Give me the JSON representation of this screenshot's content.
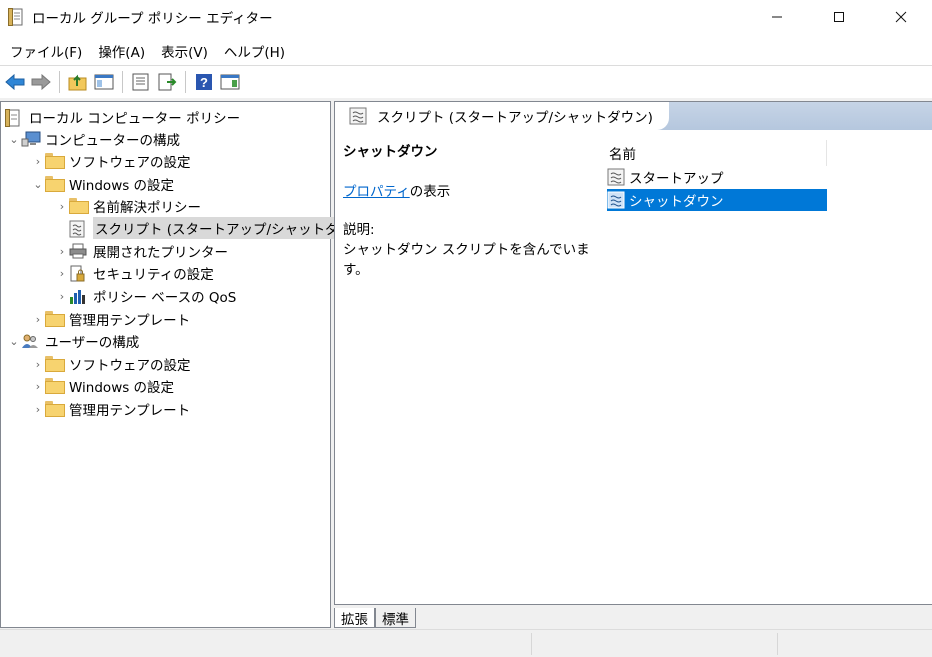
{
  "window": {
    "title": "ローカル グループ ポリシー エディター",
    "minimize": "—",
    "maximize": "☐",
    "close": "✕"
  },
  "menu": [
    "ファイル(F)",
    "操作(A)",
    "表示(V)",
    "ヘルプ(H)"
  ],
  "tree": {
    "root": "ローカル コンピューター ポリシー",
    "computer_config": "コンピューターの構成",
    "c_software": "ソフトウェアの設定",
    "c_windows": "Windows の設定",
    "c_name_resolution": "名前解決ポリシー",
    "c_scripts": "スクリプト (スタートアップ/シャットダウン)",
    "c_printers": "展開されたプリンター",
    "c_security": "セキュリティの設定",
    "c_qos": "ポリシー ベースの QoS",
    "c_admin_templates": "管理用テンプレート",
    "user_config": "ユーザーの構成",
    "u_software": "ソフトウェアの設定",
    "u_windows": "Windows の設定",
    "u_admin_templates": "管理用テンプレート"
  },
  "detail": {
    "header": "スクリプト (スタートアップ/シャットダウン)",
    "selected_title": "シャットダウン",
    "property_link": "プロパティ",
    "property_suffix": "の表示",
    "description_label": "説明:",
    "description_text": "シャットダウン スクリプトを含んでいます。",
    "column_name": "名前",
    "items": [
      "スタートアップ",
      "シャットダウン"
    ]
  },
  "tabs": [
    "拡張",
    "標準"
  ],
  "colors": {
    "selection": "#0078d7",
    "link": "#0066cc",
    "header_band": "#b5c7de"
  }
}
